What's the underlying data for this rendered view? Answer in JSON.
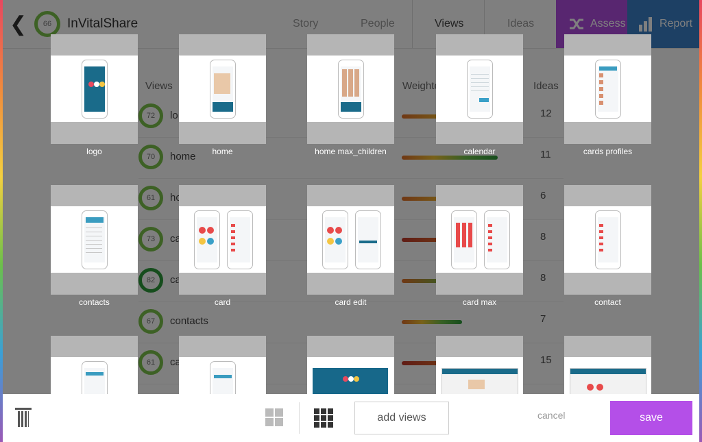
{
  "header": {
    "back_icon": "chevron-left-icon",
    "score": "66",
    "app_name": "InVitalShare",
    "tabs": [
      "Story",
      "People",
      "Views",
      "Ideas"
    ],
    "active_tab": "Views",
    "assess_label": "Assess",
    "report_label": "Report",
    "assess_color": "#b04de0",
    "report_color": "#3b80c8"
  },
  "table": {
    "col_views": "Views",
    "col_weighted": "Weighte",
    "col_ideas": "Ideas",
    "rows": [
      {
        "score": "72",
        "label": "lo",
        "ideas": "12"
      },
      {
        "score": "70",
        "label": "home",
        "ideas": "11"
      },
      {
        "score": "61",
        "label": "ho",
        "ideas": "6"
      },
      {
        "score": "73",
        "label": "ca",
        "ideas": "8"
      },
      {
        "score": "82",
        "label": "ca",
        "ideas": "8"
      },
      {
        "score": "67",
        "label": "contacts",
        "ideas": "7"
      },
      {
        "score": "61",
        "label": "ca",
        "ideas": "15"
      }
    ]
  },
  "picker": {
    "cards": [
      {
        "caption": "logo"
      },
      {
        "caption": "home"
      },
      {
        "caption": "home max_children"
      },
      {
        "caption": "calendar"
      },
      {
        "caption": "cards profiles"
      },
      {
        "caption": "contacts"
      },
      {
        "caption": "card"
      },
      {
        "caption": "card edit"
      },
      {
        "caption": "card max"
      },
      {
        "caption": "contact"
      },
      {
        "caption": ""
      },
      {
        "caption": ""
      },
      {
        "caption": ""
      },
      {
        "caption": ""
      },
      {
        "caption": ""
      }
    ]
  },
  "footer": {
    "delete_icon": "trash-icon",
    "grid_large_icon": "grid-2x2-icon",
    "grid_small_icon": "grid-3x3-icon",
    "add_views_label": "add views",
    "cancel_label": "cancel",
    "save_label": "save",
    "save_color": "#b44fe8"
  }
}
